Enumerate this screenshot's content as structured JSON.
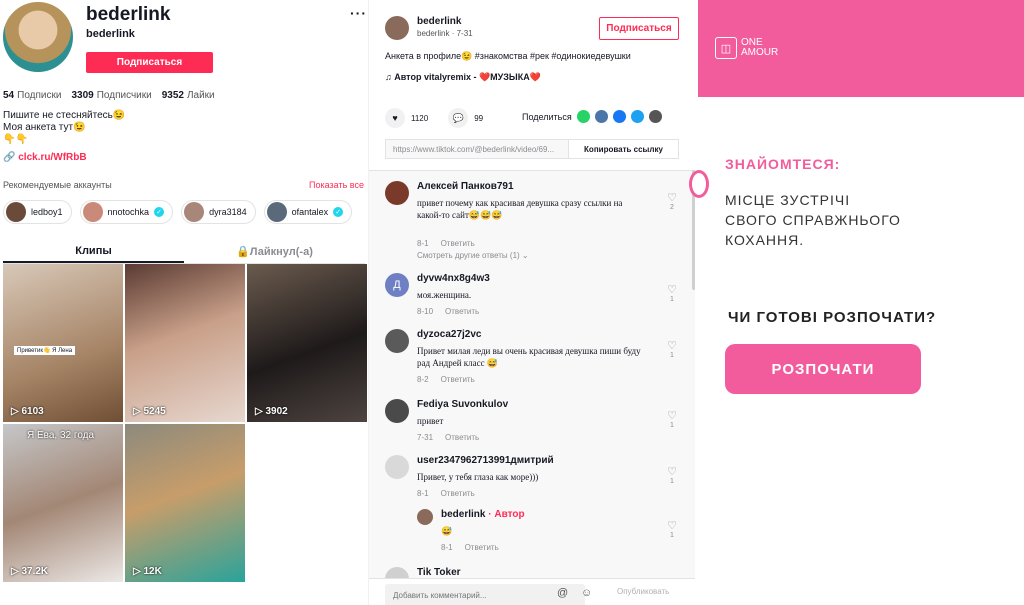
{
  "profile": {
    "username": "bederlink",
    "nickname": "bederlink",
    "subscribe_label": "Подписаться",
    "more": "···",
    "stats": [
      {
        "value": "54",
        "label": "Подписки"
      },
      {
        "value": "3309",
        "label": "Подписчики"
      },
      {
        "value": "9352",
        "label": "Лайки"
      }
    ],
    "bio_line1": "Пишите не стесняйтесь😉",
    "bio_line2": "Моя анкета тут😉",
    "bio_line3": "👇👇",
    "link": "clck.ru/WfRbB",
    "recommended_title": "Рекомендуемые аккаунты",
    "show_all": "Показать все",
    "recommended": [
      {
        "name": "ledboy1",
        "verified": false
      },
      {
        "name": "nnotochka",
        "verified": true
      },
      {
        "name": "dyra3184",
        "verified": false
      },
      {
        "name": "ofantalex",
        "verified": true
      }
    ],
    "tab_clips": "Клипы",
    "tab_liked": "🔒Лайкнул(-а)",
    "videos": [
      {
        "views": "6103",
        "caption": "Приветик👋 Я Лена"
      },
      {
        "views": "5245",
        "caption": ""
      },
      {
        "views": "3902",
        "caption": ""
      },
      {
        "views": "37.2K",
        "caption": "Я Ева, 32 года"
      },
      {
        "views": "12K",
        "caption": ""
      }
    ]
  },
  "post": {
    "author": "bederlink",
    "subline": "bederlink · 7-31",
    "subscribe_label": "Подписаться",
    "description": "Анкета в профиле😉 #знакомства #рек #одинокиедевушки",
    "music": "♫ Автор vitalyremix - ❤️МУЗЫКА❤️",
    "likes": "1120",
    "comments_count": "99",
    "share_label": "Поделиться",
    "url": "https://www.tiktok.com/@bederlink/video/69...",
    "copy_label": "Копировать ссылку"
  },
  "comments": [
    {
      "user": "Алексей Панков791",
      "text": "привет почему как красивая девушка сразу ссылки на какой-то сайт😅😅😅",
      "date": "8-1",
      "reply": "Ответить",
      "likes": "2"
    },
    {
      "user": "dyvw4nx8g4w3",
      "text": "моя.женщина.",
      "date": "8-10",
      "reply": "Ответить",
      "likes": "1"
    },
    {
      "user": "dyzoca27j2vc",
      "text": "Привет милая леди вы очень красивая девушка пиши буду рад Андрей класс 😅",
      "date": "8-2",
      "reply": "Ответить",
      "likes": "1"
    },
    {
      "user": "Fediya Suvonkulov",
      "text": "привет",
      "date": "7-31",
      "reply": "Ответить",
      "likes": "1"
    },
    {
      "user": "user2347962713991дмитрий",
      "text": "Привет, у тебя глаза как море)))",
      "date": "8-1",
      "reply": "Ответить",
      "likes": "1"
    },
    {
      "user": "bederlink",
      "author_tag": " · Автор",
      "text": "😅",
      "date": "8-1",
      "reply": "Ответить",
      "likes": "1"
    },
    {
      "user": "Tik Toker",
      "text": "",
      "date": "",
      "reply": "",
      "likes": ""
    }
  ],
  "view_more_replies": "Смотреть другие ответы (1) ⌄",
  "add_comment_placeholder": "Добавить комментарий...",
  "post_label": "Опубликовать",
  "ad": {
    "logo_text": "ONE AMOUR",
    "kicker": "ЗНАЙОМТЕСЯ:",
    "headline1": "МІСЦЕ ЗУСТРІЧІ",
    "headline2": "СВОГО СПРАВЖНЬОГО",
    "headline3": "КОХАННЯ.",
    "question": "ЧИ ГОТОВІ РОЗПОЧАТИ?",
    "cta": "РОЗПОЧАТИ"
  }
}
